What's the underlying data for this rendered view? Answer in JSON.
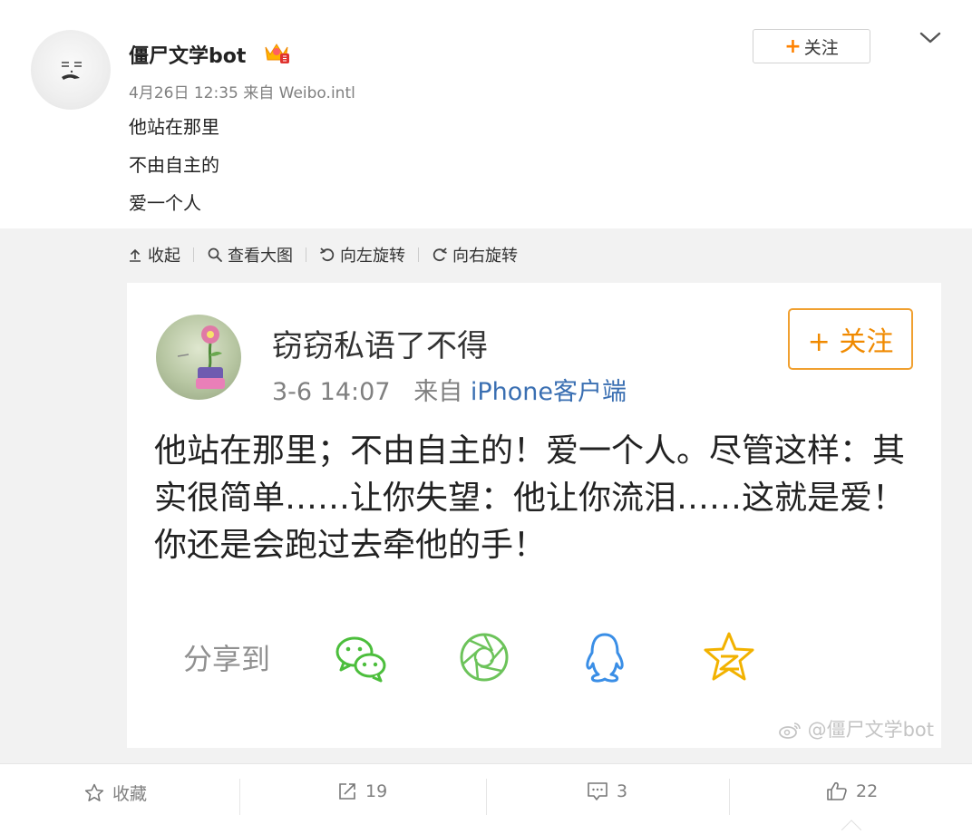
{
  "post": {
    "username": "僵尸文学bot",
    "meta": "4月26日 12:35 来自 Weibo.intl",
    "lines": [
      "他站在那里",
      "不由自主的",
      "爱一个人"
    ],
    "follow": {
      "plus": "+",
      "label": "关注"
    }
  },
  "toolbar": {
    "collapse": "收起",
    "view_large": "查看大图",
    "rotate_left": "向左旋转",
    "rotate_right": "向右旋转"
  },
  "image": {
    "name": "窃窃私语了不得",
    "follow": "+ 关注",
    "time": "3-6 14:07",
    "from": "来自",
    "source": "iPhone客户端",
    "text": "他站在那里；不由自主的！爱一个人。尽管这样：其实很简单……让你失望：他让你流泪……这就是爱！你还是会跑过去牵他的手！",
    "share_label": "分享到",
    "watermark": "@僵尸文学bot"
  },
  "actions": {
    "favorite": "收藏",
    "repost": "19",
    "comment": "3",
    "like": "22"
  },
  "icons": [
    "avatar",
    "vip-crown-icon",
    "chevron-down-icon",
    "collapse-icon",
    "search-icon",
    "rotate-left-icon",
    "rotate-right-icon",
    "wechat-icon",
    "moments-icon",
    "qq-icon",
    "qzone-icon",
    "weibo-logo-icon",
    "star-icon",
    "repost-icon",
    "comment-icon",
    "like-icon"
  ],
  "colors": {
    "accent": "#ff8200",
    "link": "#3a6fb2",
    "panel_bg": "#f2f2f2",
    "wechat": "#4cbe3c",
    "moments": "#6cc35a",
    "qq": "#3a8ee6",
    "qzone": "#f2b200"
  }
}
